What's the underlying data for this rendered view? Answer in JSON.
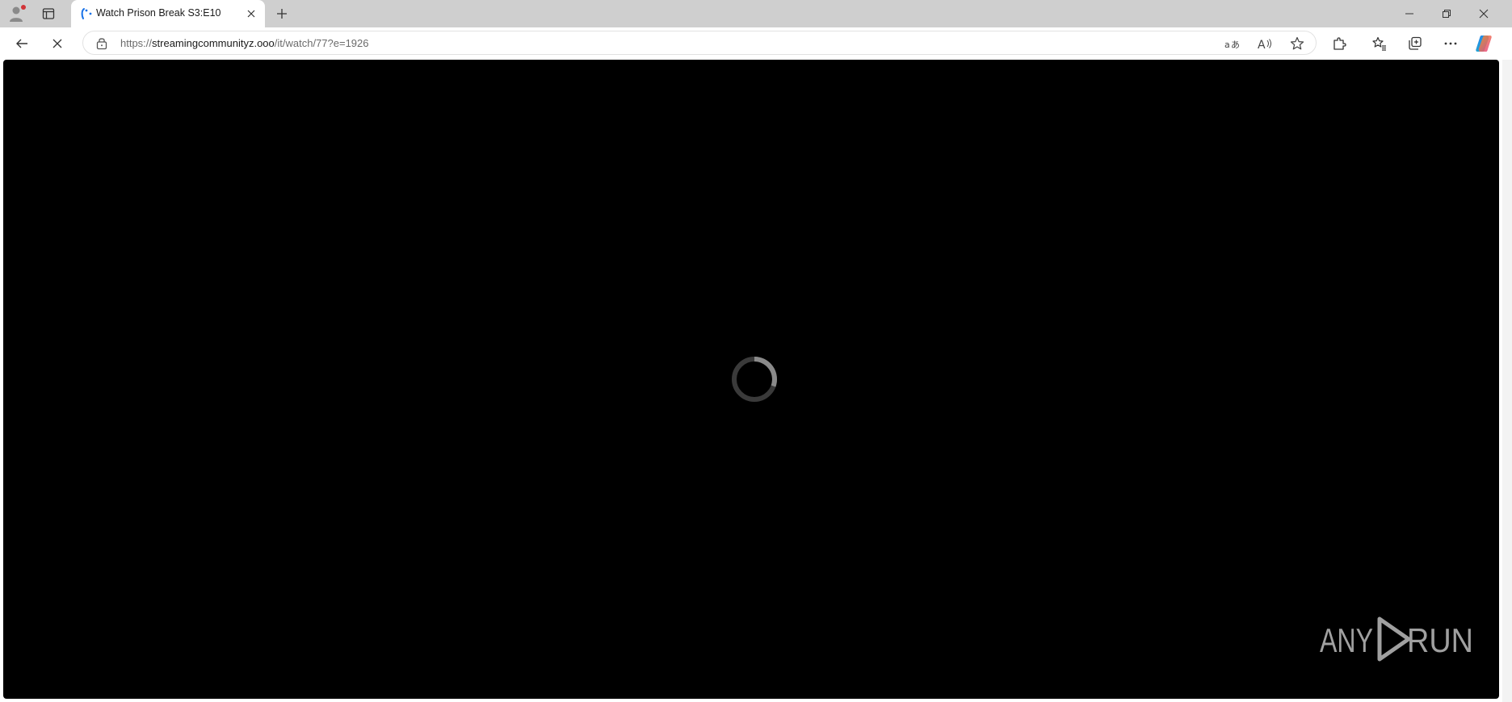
{
  "browser": {
    "tab": {
      "title": "Watch Prison Break S3:E10"
    },
    "address_bar": {
      "scheme": "https://",
      "host": "streamingcommunityz.ooo",
      "path": "/it/watch/77?e=1926"
    }
  },
  "watermark": {
    "text": "ANY RUN"
  },
  "colors": {
    "tabbar_bg": "#cfcfcf",
    "video_bg": "#000000",
    "spinner_track": "#3a3a3a",
    "spinner_arc": "#8a8a8a",
    "profile_badge": "#d13438"
  },
  "icons": [
    "profile-icon",
    "tab-actions-icon",
    "tab-favicon",
    "close-icon",
    "plus-icon",
    "minimize-icon",
    "restore-icon",
    "window-close-icon",
    "back-arrow-icon",
    "stop-loading-icon",
    "lock-icon",
    "translate-icon",
    "read-aloud-icon",
    "star-icon",
    "extensions-icon",
    "favorites-icon",
    "collections-icon",
    "more-icon",
    "copilot-icon",
    "loading-spinner"
  ]
}
